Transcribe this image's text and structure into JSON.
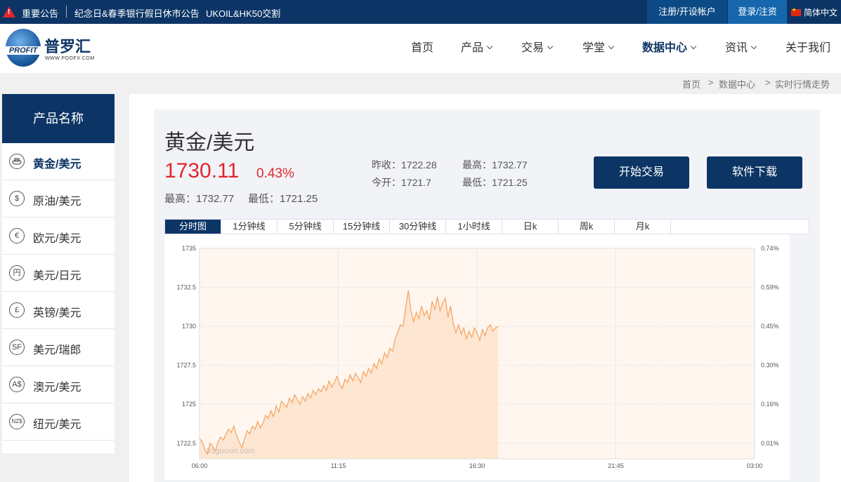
{
  "topbar": {
    "notice_label": "重要公告",
    "notice_1": "纪念日&春季银行假日休市公告",
    "notice_2": "UKOIL&HK50交割",
    "register": "注册/开设帐户",
    "login": "登录/注资",
    "language": "简体中文"
  },
  "logo": {
    "badge": "PROFIT",
    "name": "普罗汇",
    "url": "WWW.POOFX.COM"
  },
  "nav": {
    "home": "首页",
    "products": "产品",
    "trading": "交易",
    "academy": "学堂",
    "data_center": "数据中心",
    "news": "资讯",
    "about": "关于我们"
  },
  "breadcrumb": {
    "home": "首页",
    "sep1": ">",
    "data_center": "数据中心",
    "sep2": ">",
    "current": "实时行情走势"
  },
  "sidebar": {
    "title": "产品名称",
    "items": [
      {
        "label": "黄金/美元",
        "icon": "gold-icon",
        "glyph": ""
      },
      {
        "label": "原油/美元",
        "icon": "dollar-icon",
        "glyph": "$"
      },
      {
        "label": "欧元/美元",
        "icon": "euro-icon",
        "glyph": "€"
      },
      {
        "label": "美元/日元",
        "icon": "yen-icon",
        "glyph": "円"
      },
      {
        "label": "英镑/美元",
        "icon": "pound-icon",
        "glyph": "£"
      },
      {
        "label": "美元/瑞郎",
        "icon": "franc-icon",
        "glyph": "SF"
      },
      {
        "label": "澳元/美元",
        "icon": "aud-icon",
        "glyph": "A$"
      },
      {
        "label": "纽元/美元",
        "icon": "nzd-icon",
        "glyph": "NZ$"
      }
    ]
  },
  "quote": {
    "name": "黄金/美元",
    "price": "1730.11",
    "change_pct": "0.43%",
    "high_line": "最高：1732.77",
    "low_line": "最低：1721.25",
    "prev_close": "昨收：1722.28",
    "open": "今开：1721.7",
    "high": "最高：1732.77",
    "low": "最低：1721.25"
  },
  "buttons": {
    "start_trading": "开始交易",
    "download": "软件下载"
  },
  "tabs": [
    "分时图",
    "1分钟线",
    "5分钟线",
    "15分钟线",
    "30分钟线",
    "1小时线",
    "日k",
    "周k",
    "月k"
  ],
  "colors": {
    "brand": "#0c3566",
    "up": "#e1262c",
    "line": "#f5a25d",
    "fill": "#fde3cc"
  },
  "chart_data": {
    "type": "area",
    "watermark": "91guoxin.com",
    "ylim": [
      1721,
      1735
    ],
    "y_ticks": [
      1735,
      1732.5,
      1730,
      1727.5,
      1725,
      1722.5
    ],
    "y2_ticks": [
      "0.74%",
      "0.59%",
      "0.45%",
      "0.30%",
      "0.16%",
      "0.01%"
    ],
    "x_ticks": [
      "06:00",
      "11:15",
      "16:30",
      "21:45",
      "03:00"
    ],
    "x_range_hours": [
      0,
      21
    ],
    "grid": true,
    "series": [
      {
        "x": [
          0,
          0.1,
          0.2,
          0.3,
          0.4,
          0.5,
          0.6,
          0.7,
          0.8,
          0.9,
          1.0,
          1.1,
          1.2,
          1.3,
          1.4,
          1.5,
          1.6,
          1.7,
          1.8,
          1.9,
          2.0,
          2.1,
          2.2,
          2.3,
          2.4,
          2.5,
          2.6,
          2.7,
          2.8,
          2.9,
          3.0,
          3.1,
          3.2,
          3.3,
          3.4,
          3.5,
          3.6,
          3.7,
          3.8,
          3.9,
          4.0,
          4.1,
          4.2,
          4.3,
          4.4,
          4.5,
          4.6,
          4.7,
          4.8,
          4.9,
          5.0,
          5.1,
          5.2,
          5.3,
          5.4,
          5.5,
          5.6,
          5.7,
          5.8,
          5.9,
          6.0,
          6.1,
          6.2,
          6.3,
          6.4,
          6.5,
          6.6,
          6.7,
          6.8,
          6.9,
          7.0,
          7.1,
          7.2,
          7.3,
          7.4,
          7.5,
          7.6,
          7.7,
          7.8,
          7.9,
          8.0,
          8.1,
          8.2,
          8.3,
          8.4,
          8.5,
          8.6,
          8.7,
          8.8,
          8.9,
          9.0,
          9.1,
          9.2,
          9.3,
          9.4,
          9.5,
          9.6,
          9.7,
          9.8,
          9.9,
          10.0,
          10.1,
          10.2,
          10.3,
          10.4,
          10.5,
          10.6,
          10.7,
          10.8,
          10.9,
          11.0,
          11.1,
          11.2,
          11.3
        ],
        "y": [
          1722.8,
          1722.6,
          1722.1,
          1721.8,
          1722.5,
          1722.3,
          1722.0,
          1722.6,
          1722.9,
          1722.7,
          1723.1,
          1723.4,
          1723.2,
          1723.6,
          1723.0,
          1722.6,
          1722.2,
          1722.8,
          1723.3,
          1723.1,
          1723.6,
          1723.4,
          1723.9,
          1723.5,
          1723.8,
          1724.3,
          1724.1,
          1724.6,
          1724.2,
          1724.9,
          1724.5,
          1725.2,
          1725.0,
          1724.8,
          1725.4,
          1725.1,
          1725.6,
          1725.3,
          1725.0,
          1725.5,
          1725.2,
          1725.7,
          1725.4,
          1725.9,
          1725.6,
          1726.0,
          1725.8,
          1726.2,
          1725.9,
          1726.5,
          1726.1,
          1726.4,
          1726.8,
          1726.3,
          1726.0,
          1726.6,
          1726.4,
          1726.9,
          1726.5,
          1727.0,
          1726.7,
          1726.4,
          1727.1,
          1726.8,
          1727.3,
          1727.0,
          1727.6,
          1727.3,
          1727.9,
          1727.6,
          1728.3,
          1728.0,
          1728.6,
          1728.4,
          1729.2,
          1729.6,
          1730.1,
          1730.0,
          1731.2,
          1732.3,
          1731.0,
          1730.3,
          1730.9,
          1730.5,
          1731.3,
          1730.7,
          1731.0,
          1730.4,
          1731.6,
          1731.1,
          1731.9,
          1731.0,
          1731.5,
          1731.8,
          1730.6,
          1731.3,
          1730.2,
          1729.6,
          1730.1,
          1729.5,
          1729.9,
          1729.2,
          1729.7,
          1729.3,
          1729.9,
          1729.6,
          1729.1,
          1729.8,
          1729.4,
          1729.9,
          1730.1,
          1729.7,
          1729.9,
          1730.0
        ]
      }
    ]
  }
}
